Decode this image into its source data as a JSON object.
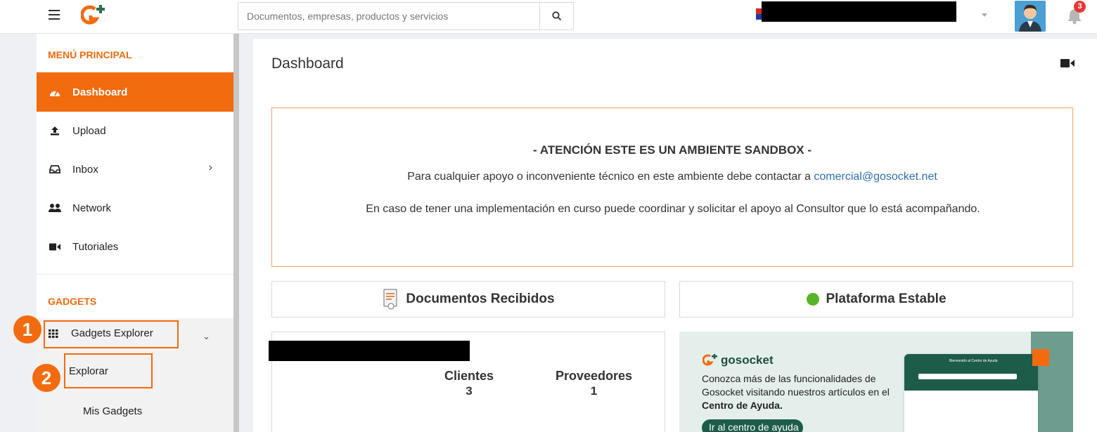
{
  "topbar": {
    "search_placeholder": "Documentos, empresas, productos y servicios",
    "notification_count": "3"
  },
  "sidebar": {
    "main_menu_title": "MENÚ PRINCIPAL",
    "items": [
      {
        "label": "Dashboard",
        "icon": "dashboard-icon",
        "active": true
      },
      {
        "label": "Upload",
        "icon": "upload-icon"
      },
      {
        "label": "Inbox",
        "icon": "inbox-icon",
        "has_submenu": true
      },
      {
        "label": "Network",
        "icon": "network-icon"
      },
      {
        "label": "Tutoriales",
        "icon": "video-icon"
      }
    ],
    "gadgets_title": "GADGETS",
    "gadgets_explorer": "Gadgets Explorer",
    "sub_items": [
      "Explorar",
      "Mis Gadgets"
    ]
  },
  "markers": [
    "1",
    "2"
  ],
  "main": {
    "title": "Dashboard",
    "sandbox": {
      "title": "- ATENCIÓN ESTE ES UN AMBIENTE SANDBOX -",
      "line1": "Para cualquier apoyo o inconveniente técnico en este ambiente debe contactar a ",
      "email": "comercial@gosocket.net",
      "line2": "En caso de tener una implementación en curso puede coordinar y solicitar el apoyo al Consultor que lo está acompañando."
    },
    "documents_card": {
      "title": "Documentos Recibidos",
      "clients_label": "Clientes",
      "clients_value": "3",
      "providers_label": "Proveedores",
      "providers_value": "1"
    },
    "platform_card": {
      "title": "Plataforma Estable",
      "status_color": "#58b52a"
    },
    "promo": {
      "brand": "gosocket",
      "text_before": "Conozca más de las funcionalidades de Gosocket visitando nuestros artículos en el ",
      "text_bold": "Centro de Ayuda.",
      "button": "Ir al centro de ayuda",
      "mock_title": "Bienvenido al Centro de Ayuda"
    }
  },
  "colors": {
    "accent": "#f26b0f",
    "link": "#2f6db3",
    "promo_green": "#1e5c4a"
  }
}
